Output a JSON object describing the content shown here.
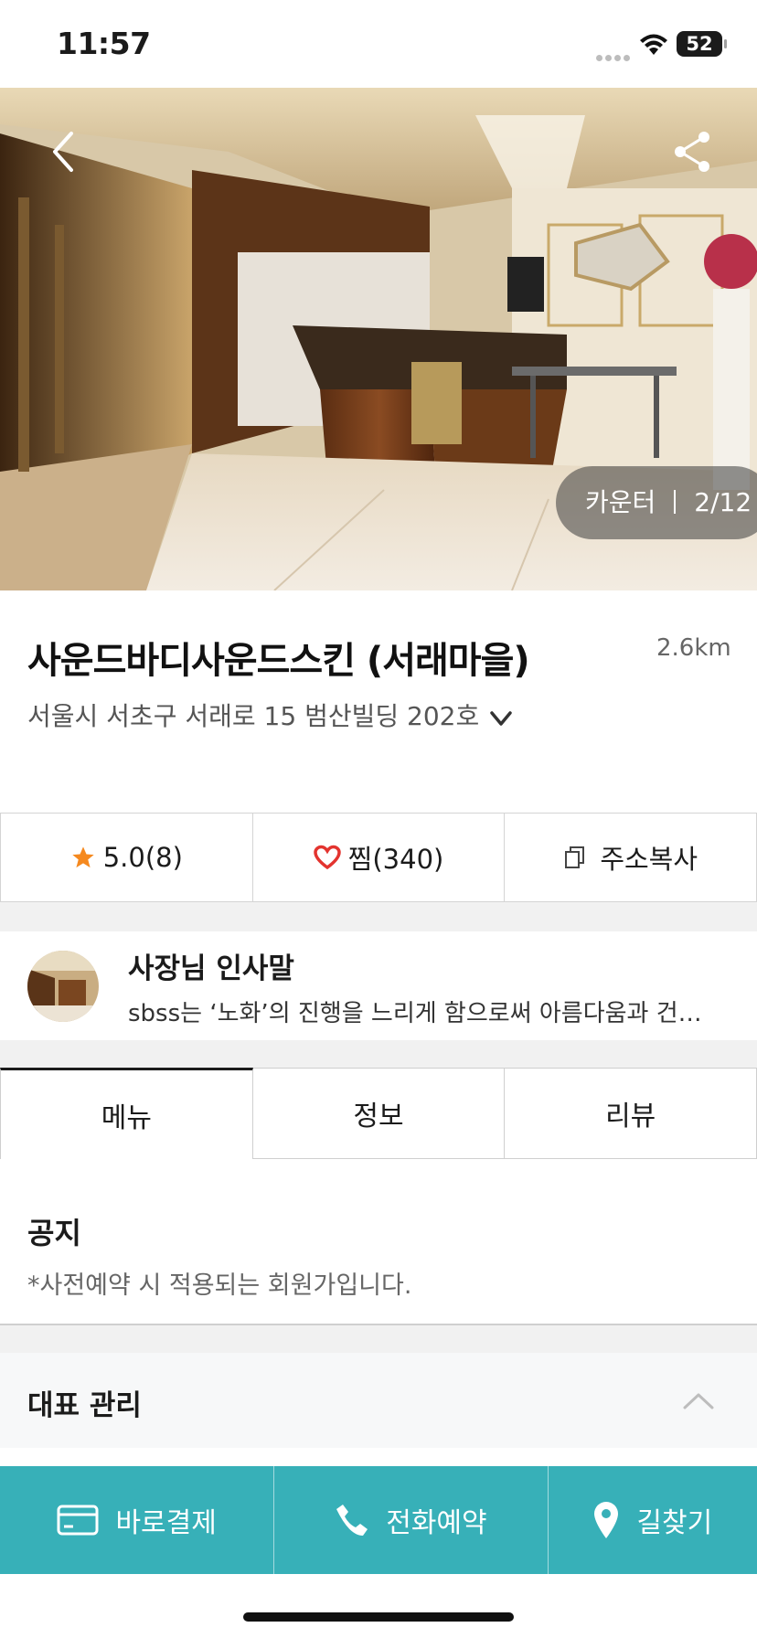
{
  "status_bar": {
    "time": "11:57",
    "battery": "52"
  },
  "hero": {
    "photo_caption": "카운터",
    "photo_index": "2/12"
  },
  "shop": {
    "name": "사운드바디사운드스킨 (서래마을)",
    "distance": "2.6km",
    "address": "서울시 서초구 서래로 15 범산빌딩 202호"
  },
  "actions": {
    "rating": "5.0(8)",
    "wishlist": "찜(340)",
    "copy_address": "주소복사"
  },
  "owner": {
    "title": "사장님 인사말",
    "message": "sbss는 ‘노화’의 진행을 느리게 함으로써 아름다움과 건…"
  },
  "tabs": [
    {
      "label": "메뉴",
      "active": true
    },
    {
      "label": "정보",
      "active": false
    },
    {
      "label": "리뷰",
      "active": false
    }
  ],
  "notice": {
    "title": "공지",
    "text": "*사전예약 시 적용되는 회원가입니다."
  },
  "section": {
    "title": "대표 관리"
  },
  "bottom_bar": {
    "pay": "바로결제",
    "call": "전화예약",
    "directions": "길찾기"
  },
  "colors": {
    "accent_teal": "#37b0b8",
    "star_orange": "#f5891f",
    "heart_red": "#e3342f"
  },
  "icons": [
    "back-arrow-icon",
    "share-icon",
    "star-icon",
    "heart-icon",
    "copy-icon",
    "chevron-down-icon",
    "chevron-up-icon",
    "card-icon",
    "phone-icon",
    "location-pin-icon",
    "wifi-icon"
  ]
}
